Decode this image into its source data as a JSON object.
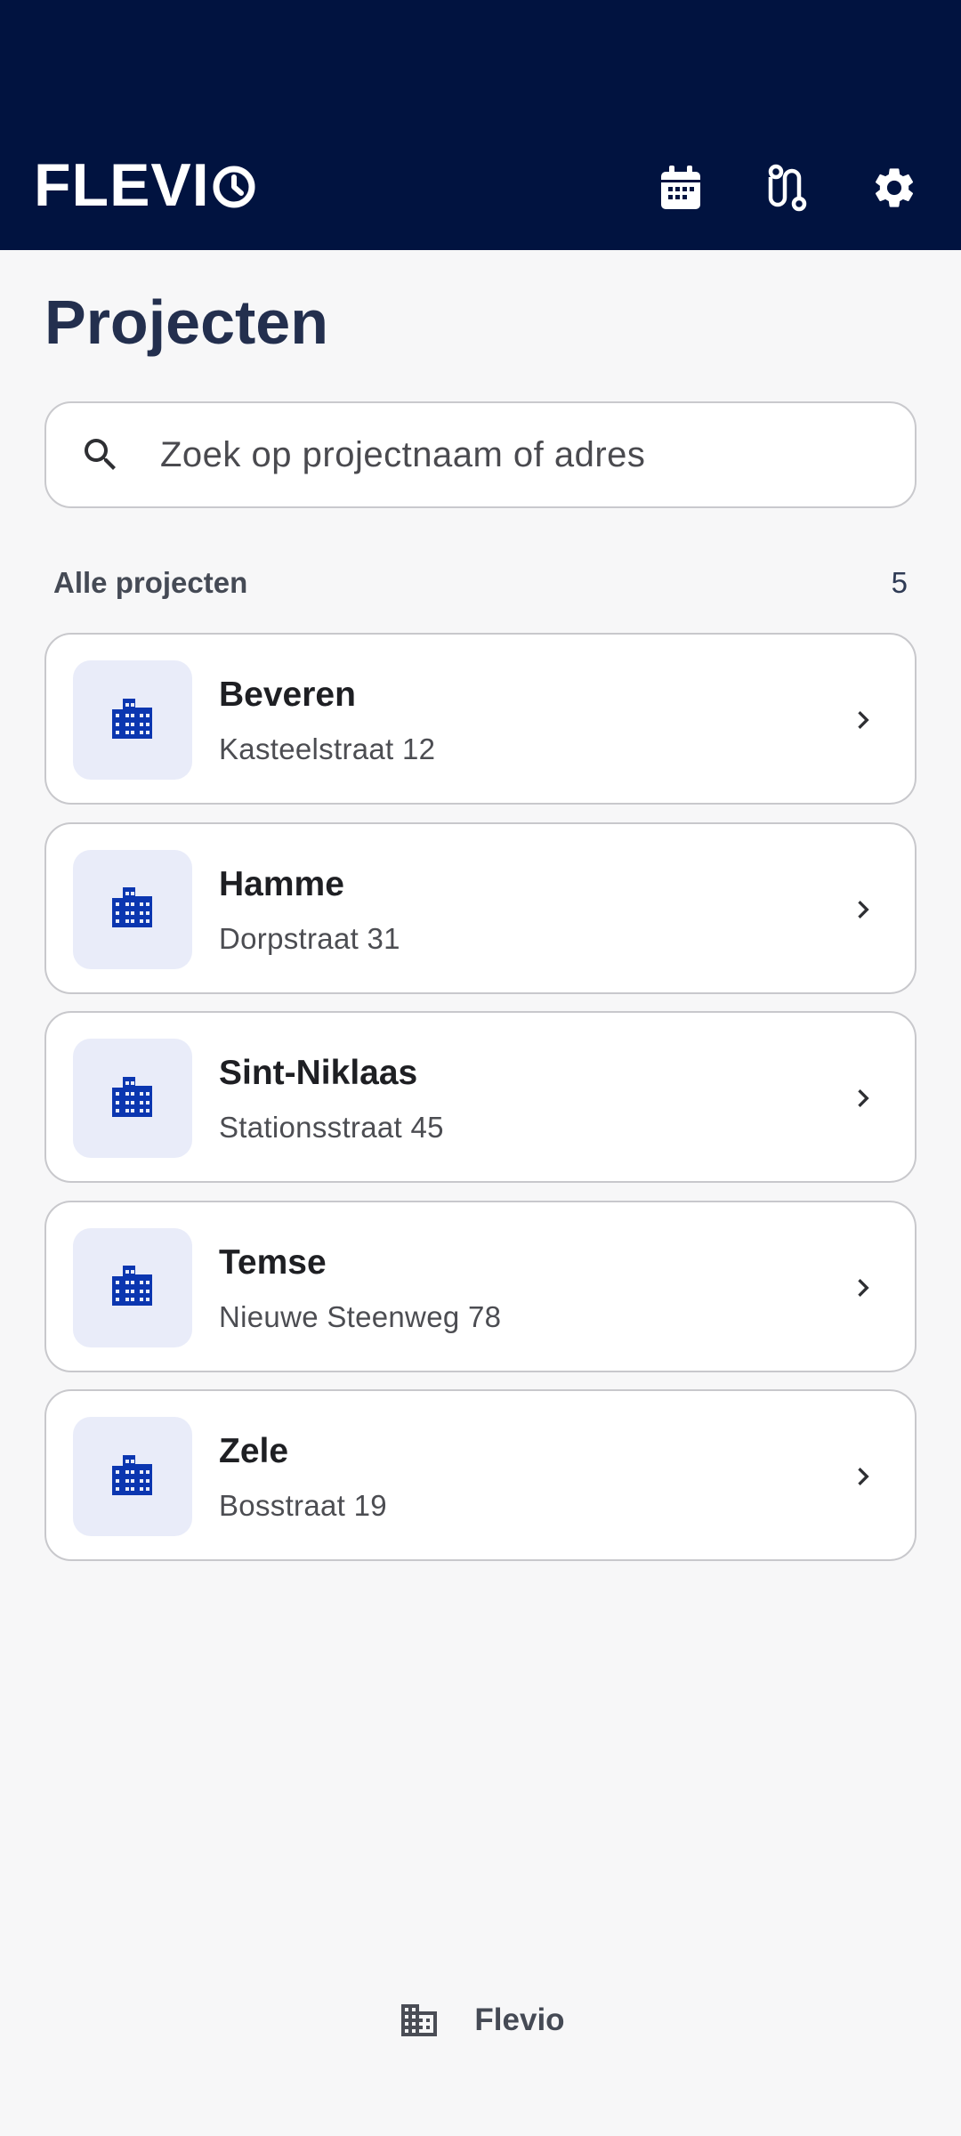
{
  "colors": {
    "header_bg": "#011340",
    "title": "#232f4e",
    "icon_blue": "#0b36b0",
    "thumb_bg": "#e9ecf9",
    "page_bg": "#f7f7f8"
  },
  "header": {
    "logo_text": "FLEVI",
    "actions": [
      {
        "name": "calendar-icon"
      },
      {
        "name": "route-icon"
      },
      {
        "name": "gear-icon"
      }
    ]
  },
  "page": {
    "title": "Projecten"
  },
  "search": {
    "placeholder": "Zoek op projectnaam of adres",
    "value": ""
  },
  "section": {
    "label": "Alle projecten",
    "count": "5"
  },
  "projects": [
    {
      "name": "Beveren",
      "address": "Kasteelstraat 12",
      "icon": "building-icon"
    },
    {
      "name": "Hamme",
      "address": "Dorpstraat 31",
      "icon": "building-icon"
    },
    {
      "name": "Sint-Niklaas",
      "address": "Stationsstraat 45",
      "icon": "building-icon"
    },
    {
      "name": "Temse",
      "address": "Nieuwe Steenweg 78",
      "icon": "building-icon"
    },
    {
      "name": "Zele",
      "address": "Bosstraat 19",
      "icon": "building-icon"
    }
  ],
  "footer": {
    "label": "Flevio",
    "icon": "building-icon"
  }
}
